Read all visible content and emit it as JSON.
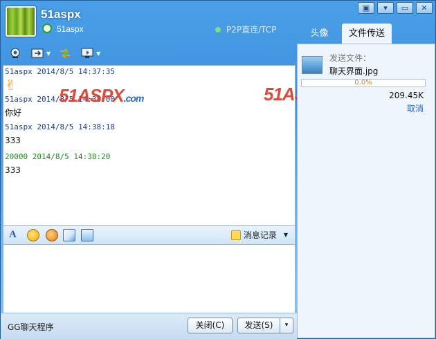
{
  "window": {
    "username": "51aspx",
    "signature": "51aspx",
    "connection": "P2P直连/TCP",
    "controls": [
      "▣",
      "▾",
      "▭",
      "✕"
    ]
  },
  "toolbar": {
    "icons": [
      "webcam-icon",
      "send-file-icon",
      "transfer-icon",
      "remote-desktop-icon"
    ]
  },
  "chat": {
    "messages": [
      {
        "header": "51aspx  2014/8/5 14:37:35",
        "body": "✌",
        "color": "#1f3c88"
      },
      {
        "header": "51aspx  2014/8/5 14:38:00",
        "body": "你好",
        "color": "#1f3c88"
      },
      {
        "header": "51aspx  2014/8/5 14:38:18",
        "body": "333",
        "color": "#1f3c88"
      },
      {
        "header": "20000  2014/8/5 14:38:20",
        "body": "333",
        "color": "#1a8a1a"
      }
    ],
    "watermark_main": "51ASPX",
    "watermark_suffix": ".com"
  },
  "format_bar": {
    "history_label": "消息记录"
  },
  "bottom": {
    "app_name": "GG聊天程序",
    "close_label": "关闭(C)",
    "send_label": "发送(S)",
    "send_arrow": "▾"
  },
  "right_panel": {
    "tabs": [
      "头像",
      "文件传送"
    ],
    "file_label": "发送文件：",
    "file_name": "聊天界面.jpg",
    "progress_text": "0.0%",
    "progress_value": 0,
    "file_size": "209.45K",
    "cancel_label": "取消"
  },
  "colors": {
    "accent": "#3f8fdd",
    "watermark_red": "#d43a2a",
    "watermark_blue": "#1d56b0"
  }
}
